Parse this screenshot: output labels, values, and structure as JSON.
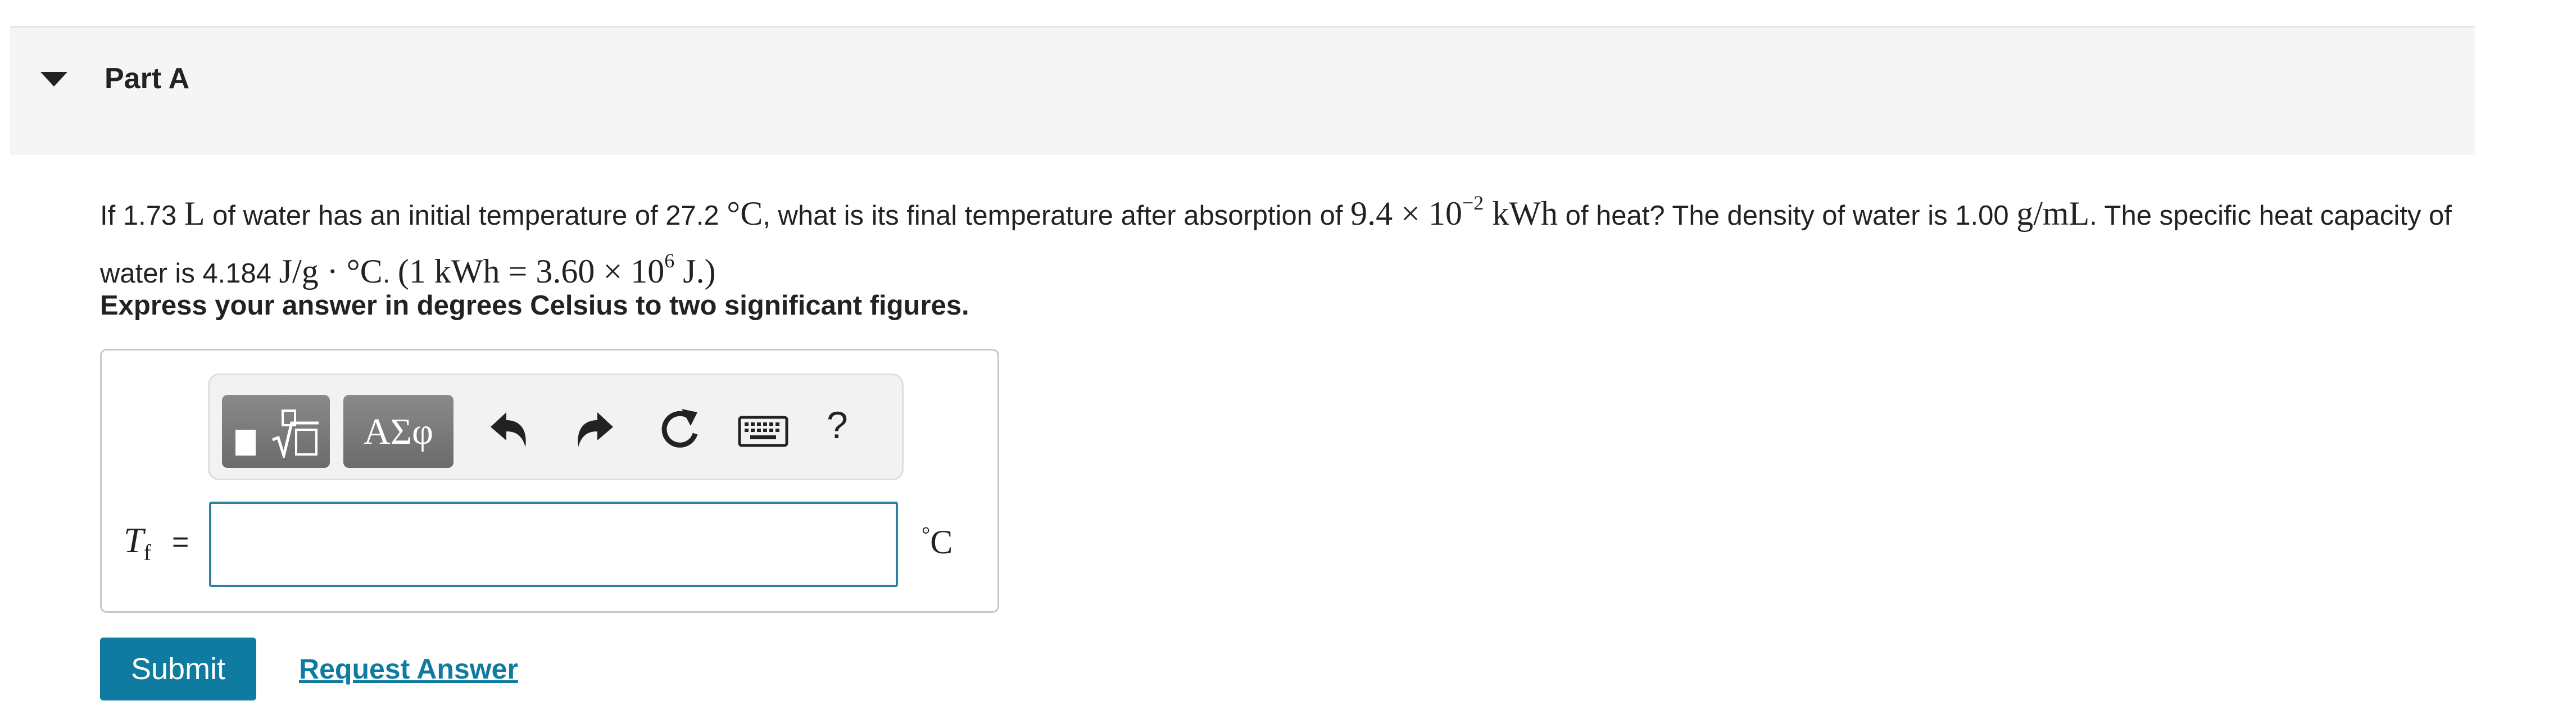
{
  "part": {
    "title": "Part A"
  },
  "question": {
    "t1": "If 1.73 ",
    "m_l": "L",
    "t2": " of water has an initial temperature of 27.2 ",
    "m_c1": "°C",
    "t3": ", what is its final temperature after absorption of ",
    "m_e_base": "9.4 × 10",
    "m_e_exp": "−2",
    "m_e_unit": " kWh",
    "t4": " of heat? The density of water is 1.00 ",
    "m_gml": "g/mL",
    "t5": ". The specific heat capacity of water is 4.184 ",
    "m_shc": "J/g · °C",
    "t6": ". ",
    "m_conv_base": "(1 kWh = 3.60 × 10",
    "m_conv_exp": "6",
    "m_conv_unit": " J.)"
  },
  "instruction": "Express your answer in degrees Celsius to two significant figures.",
  "toolbar": {
    "templates_icon": "square-root-template-icon",
    "greek_label": "ΑΣφ",
    "undo_icon": "undo-icon",
    "redo_icon": "redo-icon",
    "reset_icon": "reset-icon",
    "keyboard_icon": "keyboard-icon",
    "help_label": "?"
  },
  "answer": {
    "variable": "T",
    "variable_sub": "f",
    "equals": "=",
    "value": "",
    "unit_sup": "°",
    "unit": "C"
  },
  "actions": {
    "submit_label": "Submit",
    "request_label": "Request Answer"
  },
  "colors": {
    "accent": "#0f7ba1",
    "input_border": "#2e7fa0",
    "header_bg": "#f5f5f5",
    "toolbar_button": "#777777"
  }
}
